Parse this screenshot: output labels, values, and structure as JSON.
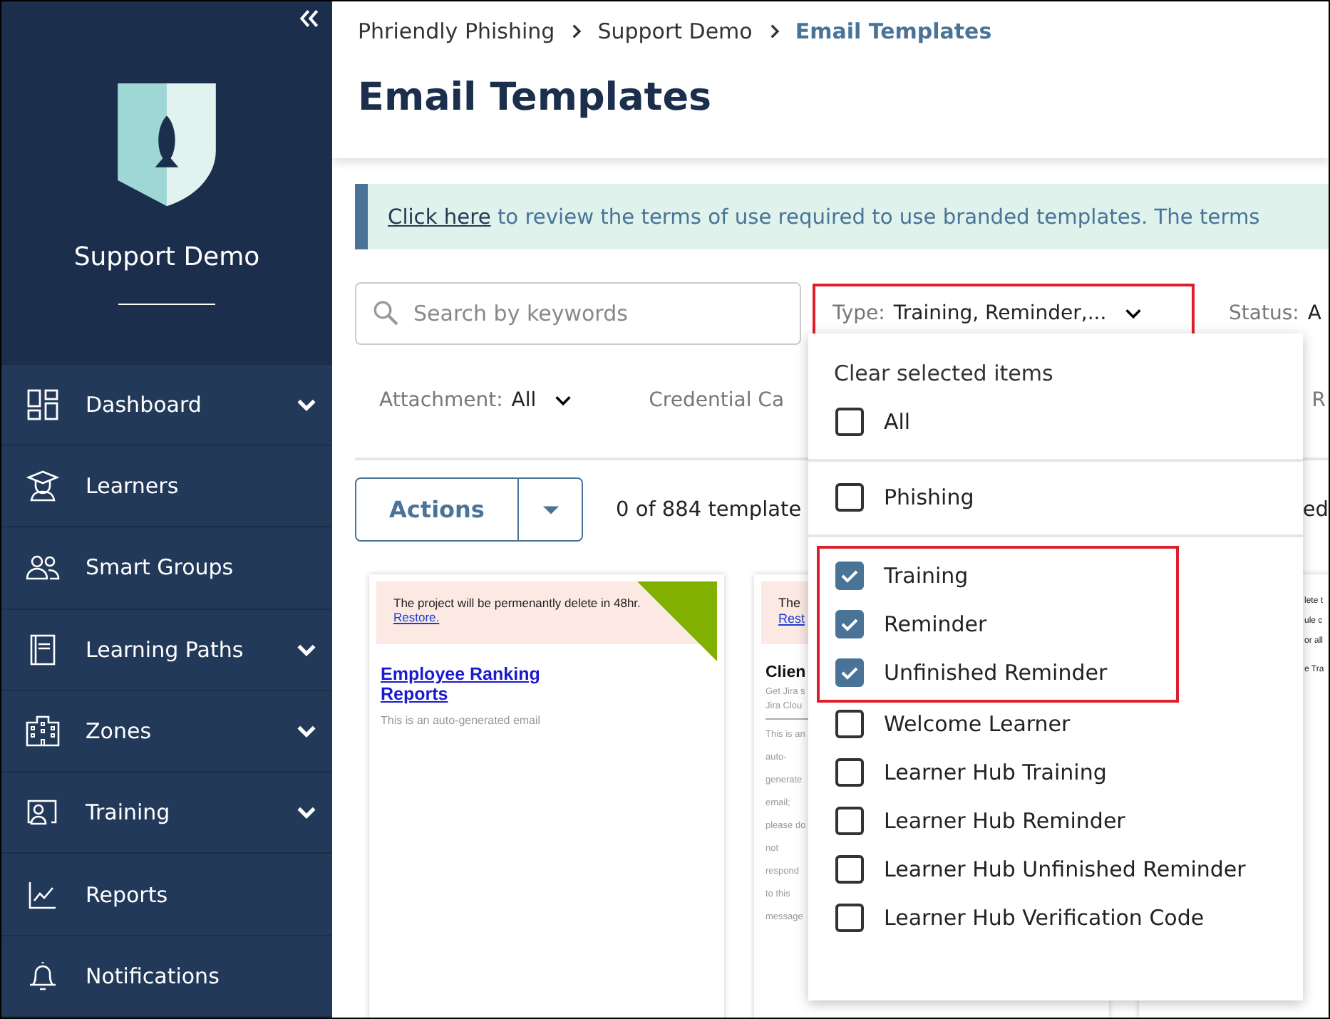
{
  "sidebar": {
    "org_name": "Support Demo",
    "items": [
      {
        "label": "Dashboard",
        "kind": "grid",
        "expandable": true
      },
      {
        "label": "Learners",
        "kind": "graduate",
        "expandable": false
      },
      {
        "label": "Smart Groups",
        "kind": "people",
        "expandable": false
      },
      {
        "label": "Learning Paths",
        "kind": "book",
        "expandable": true
      },
      {
        "label": "Zones",
        "kind": "building",
        "expandable": true
      },
      {
        "label": "Training",
        "kind": "card",
        "expandable": true
      },
      {
        "label": "Reports",
        "kind": "chart",
        "expandable": false
      },
      {
        "label": "Notifications",
        "kind": "bell",
        "expandable": false
      }
    ]
  },
  "breadcrumb": [
    {
      "label": "Phriendly Phishing",
      "current": false
    },
    {
      "label": "Support Demo",
      "current": false
    },
    {
      "label": "Email Templates",
      "current": true
    }
  ],
  "page_title": "Email Templates",
  "notice": {
    "link": "Click here",
    "text": " to review the terms of use required to use branded templates. The terms"
  },
  "search": {
    "placeholder": "Search by keywords"
  },
  "filters": [
    {
      "label": "Type:",
      "value": "Training, Reminder,...",
      "chevron": true,
      "highlighted": true
    },
    {
      "label": "Status:",
      "value": "A",
      "highlighted": false
    }
  ],
  "filters_row_2": [
    {
      "label": "Attachment:",
      "value": "All",
      "chevron": true
    },
    {
      "label": "Credential Ca",
      "chevron": false
    },
    {
      "label": "R",
      "chevron": false
    }
  ],
  "actions": {
    "label": "Actions",
    "count": "0 of 884 template",
    "trailing": "ed"
  },
  "type_dropdown": {
    "clear": "Clear selected items",
    "groups": [
      [
        {
          "label": "All",
          "checked": false,
          "highlighted": false
        }
      ],
      [
        {
          "label": "Phishing",
          "checked": false,
          "highlighted": false
        }
      ],
      [
        {
          "label": "Training",
          "checked": true,
          "highlighted": true
        },
        {
          "label": "Reminder",
          "checked": true,
          "highlighted": true
        },
        {
          "label": "Unfinished Reminder",
          "checked": true,
          "highlighted": true
        },
        {
          "label": "Welcome Learner",
          "checked": false,
          "highlighted": false
        },
        {
          "label": "Learner Hub Training",
          "checked": false,
          "highlighted": false
        },
        {
          "label": "Learner Hub Reminder",
          "checked": false,
          "highlighted": false
        },
        {
          "label": "Learner Hub Unfinished Reminder",
          "checked": false,
          "highlighted": false
        },
        {
          "label": "Learner Hub Verification Code",
          "checked": false,
          "highlighted": false
        }
      ]
    ]
  },
  "cards": [
    {
      "kind": "full",
      "notice": "The project will be permenantly delete in 48hr.",
      "restore": "Restore.",
      "title": "Employee Ranking Reports",
      "lines": [
        "This is an auto-generated email"
      ],
      "corner": true
    },
    {
      "kind": "left",
      "notice": "The",
      "restore": "Rest",
      "title": "Clien",
      "lines": [
        "Get Jira s",
        "Jira Clou"
      ],
      "body": [
        "This is an",
        "auto-",
        "generate",
        "email;",
        "please do",
        "not",
        "respond",
        "to this",
        "message"
      ]
    },
    {
      "kind": "right",
      "lines": [
        "lete t",
        "ule c",
        "or all"
      ],
      "body": [
        "e Tra"
      ]
    }
  ]
}
